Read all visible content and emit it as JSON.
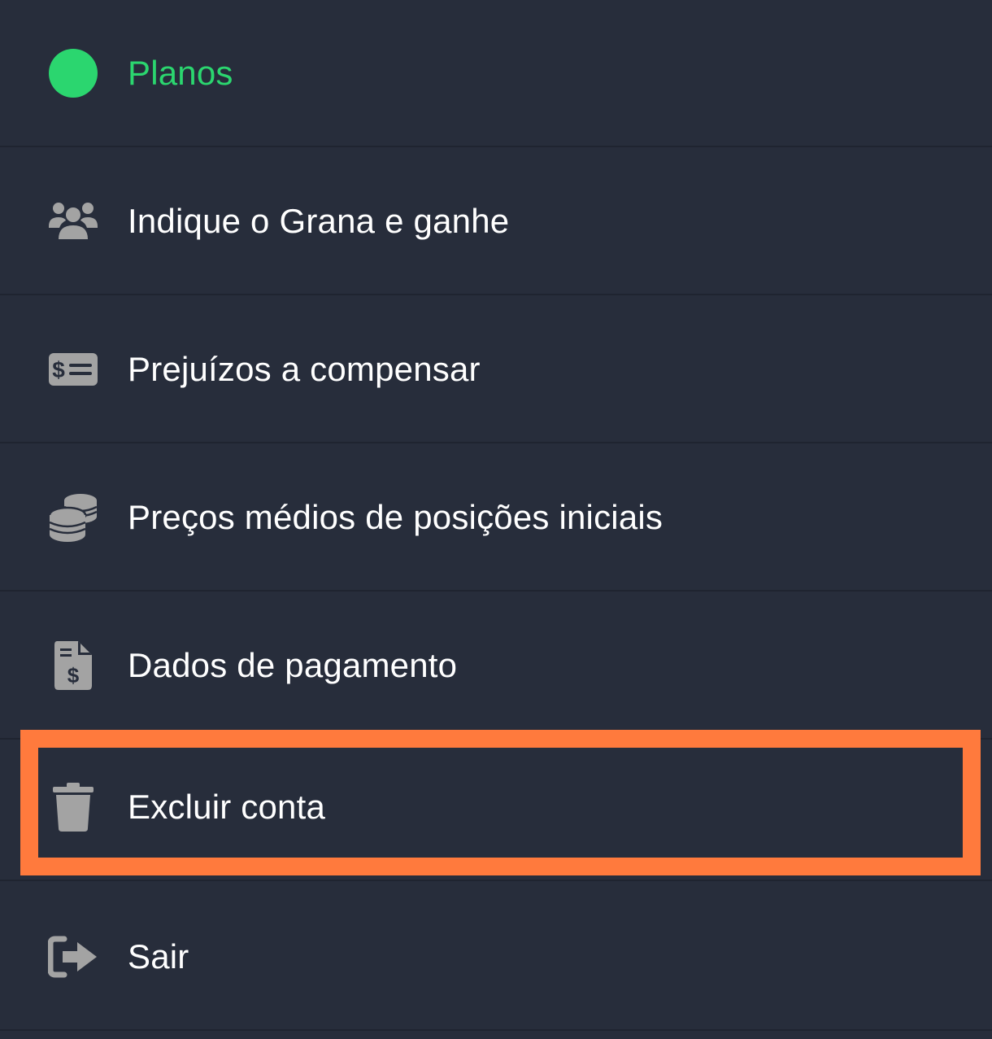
{
  "colors": {
    "background": "#272d3b",
    "divider": "#1f2430",
    "accent": "#2bd66f",
    "icon": "#a3a3a3",
    "highlight": "#ff7a3d"
  },
  "menu": {
    "items": [
      {
        "label": "Planos",
        "icon": "green-dot-icon"
      },
      {
        "label": "Indique o Grana e ganhe",
        "icon": "users-group-icon"
      },
      {
        "label": "Prejuízos a compensar",
        "icon": "money-check-icon"
      },
      {
        "label": "Preços médios de posições iniciais",
        "icon": "coins-stack-icon"
      },
      {
        "label": "Dados de pagamento",
        "icon": "invoice-dollar-icon"
      },
      {
        "label": "Excluir conta",
        "icon": "trash-icon"
      },
      {
        "label": "Sair",
        "icon": "sign-out-icon"
      }
    ]
  }
}
